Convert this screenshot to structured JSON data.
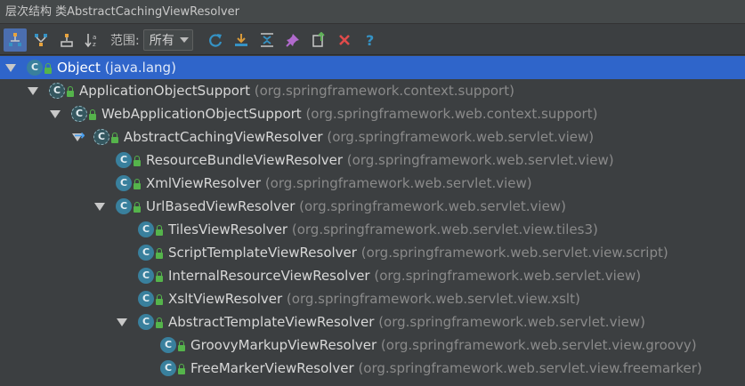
{
  "window": {
    "title": "层次结构 类AbstractCachingViewResolver"
  },
  "toolbar": {
    "buttons": [
      {
        "icon": "subtypes-hierarchy-icon",
        "tooltip": ""
      },
      {
        "icon": "supertypes-hierarchy-icon",
        "tooltip": ""
      },
      {
        "icon": "class-hierarchy-icon",
        "tooltip": ""
      },
      {
        "icon": "sort-alpha-icon",
        "tooltip": ""
      }
    ],
    "scope_label": "范围:",
    "scope_value": "所有",
    "actions": [
      {
        "icon": "refresh-icon"
      },
      {
        "icon": "expand-all-icon"
      },
      {
        "icon": "collapse-all-icon"
      },
      {
        "icon": "pin-icon"
      },
      {
        "icon": "export-icon"
      },
      {
        "icon": "close-icon"
      },
      {
        "icon": "help-icon"
      }
    ],
    "colors": {
      "refresh": "#3592c4",
      "close": "#e04b4b",
      "help": "#3592c4",
      "pin": "#b16acd",
      "export": "#5fb158",
      "expand": "#d89a3a"
    }
  },
  "tree": {
    "selected_color": "#2f65ca",
    "nodes": [
      {
        "name": "Object",
        "package": "(java.lang)",
        "level": 0,
        "expanded": true,
        "abstract": false,
        "selected": true,
        "current": false
      },
      {
        "name": "ApplicationObjectSupport",
        "package": "(org.springframework.context.support)",
        "level": 1,
        "expanded": true,
        "abstract": true,
        "selected": false,
        "current": false
      },
      {
        "name": "WebApplicationObjectSupport",
        "package": "(org.springframework.web.context.support)",
        "level": 2,
        "expanded": true,
        "abstract": true,
        "selected": false,
        "current": false
      },
      {
        "name": "AbstractCachingViewResolver",
        "package": "(org.springframework.web.servlet.view)",
        "level": 3,
        "expanded": true,
        "abstract": true,
        "selected": false,
        "current": true
      },
      {
        "name": "ResourceBundleViewResolver",
        "package": "(org.springframework.web.servlet.view)",
        "level": 4,
        "expanded": false,
        "abstract": false,
        "selected": false,
        "current": false
      },
      {
        "name": "XmlViewResolver",
        "package": "(org.springframework.web.servlet.view)",
        "level": 4,
        "expanded": false,
        "abstract": false,
        "selected": false,
        "current": false
      },
      {
        "name": "UrlBasedViewResolver",
        "package": "(org.springframework.web.servlet.view)",
        "level": 4,
        "expanded": true,
        "abstract": false,
        "selected": false,
        "current": false
      },
      {
        "name": "TilesViewResolver",
        "package": "(org.springframework.web.servlet.view.tiles3)",
        "level": 5,
        "expanded": false,
        "abstract": false,
        "selected": false,
        "current": false
      },
      {
        "name": "ScriptTemplateViewResolver",
        "package": "(org.springframework.web.servlet.view.script)",
        "level": 5,
        "expanded": false,
        "abstract": false,
        "selected": false,
        "current": false
      },
      {
        "name": "InternalResourceViewResolver",
        "package": "(org.springframework.web.servlet.view)",
        "level": 5,
        "expanded": false,
        "abstract": false,
        "selected": false,
        "current": false
      },
      {
        "name": "XsltViewResolver",
        "package": "(org.springframework.web.servlet.view.xslt)",
        "level": 5,
        "expanded": false,
        "abstract": false,
        "selected": false,
        "current": false
      },
      {
        "name": "AbstractTemplateViewResolver",
        "package": "(org.springframework.web.servlet.view)",
        "level": 5,
        "expanded": true,
        "abstract": false,
        "selected": false,
        "current": false
      },
      {
        "name": "GroovyMarkupViewResolver",
        "package": "(org.springframework.web.servlet.view.groovy)",
        "level": 6,
        "expanded": false,
        "abstract": false,
        "selected": false,
        "current": false
      },
      {
        "name": "FreeMarkerViewResolver",
        "package": "(org.springframework.web.servlet.view.freemarker)",
        "level": 6,
        "expanded": false,
        "abstract": false,
        "selected": false,
        "current": false
      }
    ],
    "icon_letter": "C"
  }
}
